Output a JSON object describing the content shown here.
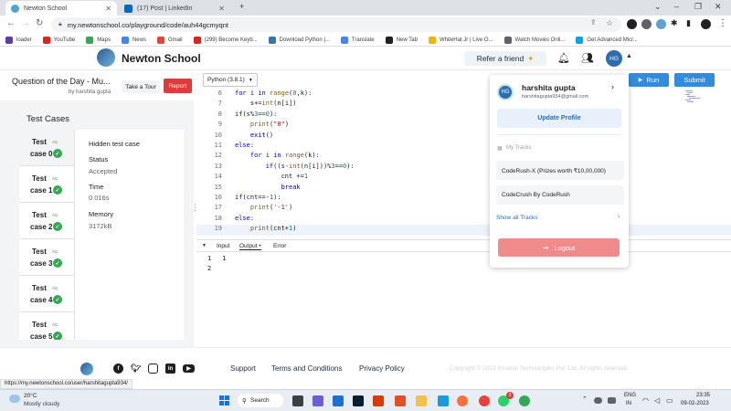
{
  "browser": {
    "tabs": [
      {
        "title": "Newton School",
        "active": true,
        "favicon_color": "#4ea3d8"
      },
      {
        "title": "(17) Post | LinkedIn",
        "active": false,
        "favicon_color": "#0a66c2"
      }
    ],
    "url": "my.newtonschool.co/playground/code/auh44gcmyqnt",
    "bookmarks": [
      {
        "label": "loader",
        "color": "#5b3ea6"
      },
      {
        "label": "YouTube",
        "color": "#e62117"
      },
      {
        "label": "Maps",
        "color": "#34a853"
      },
      {
        "label": "News",
        "color": "#4285f4"
      },
      {
        "label": "Gmail",
        "color": "#ea4335"
      },
      {
        "label": "(299) Become Keyb...",
        "color": "#e62117"
      },
      {
        "label": "Download Python |...",
        "color": "#3776ab"
      },
      {
        "label": "Translate",
        "color": "#4285f4"
      },
      {
        "label": "New Tab",
        "color": "#202124"
      },
      {
        "label": "WhiteHat Jr | Live O...",
        "color": "#f4b400"
      },
      {
        "label": "Watch Movies Onli...",
        "color": "#5f6368"
      },
      {
        "label": "Get Advanced Micr...",
        "color": "#00a4ef"
      }
    ],
    "status_url": "https://my.newtonschool.co/user/harshitagupta934/"
  },
  "site": {
    "brand": "Newton School",
    "refer_label": "Refer a friend",
    "avatar_initials": "HG"
  },
  "question": {
    "title": "Question of the Day - Mu...",
    "author": "by harshita gupta",
    "tour_label": "Take a Tour",
    "report_label": "Report"
  },
  "testcases": {
    "heading": "Test Cases",
    "items": [
      {
        "line1": "Test",
        "line2": "case 0",
        "badge": "AC"
      },
      {
        "line1": "Test",
        "line2": "case 1",
        "badge": "AC"
      },
      {
        "line1": "Test",
        "line2": "case 2",
        "badge": "AC"
      },
      {
        "line1": "Test",
        "line2": "case 3",
        "badge": "AC"
      },
      {
        "line1": "Test",
        "line2": "case 4",
        "badge": "AC"
      },
      {
        "line1": "Test",
        "line2": "case 5",
        "badge": "AC"
      }
    ],
    "detail": {
      "title": "Hidden test case",
      "status_label": "Status",
      "status_value": "Accepted",
      "time_label": "Time",
      "time_value": "0.016s",
      "memory_label": "Memory",
      "memory_value": "3172kB"
    }
  },
  "editor": {
    "language": "Python (3.8.1)",
    "run_label": "Run",
    "submit_label": "Submit",
    "lines": [
      {
        "n": "6",
        "code": "for i in range(0,k):"
      },
      {
        "n": "7",
        "code": "    s+=int(n[i])"
      },
      {
        "n": "8",
        "code": "if(s%3==0):"
      },
      {
        "n": "9",
        "code": "    print(\"0\")"
      },
      {
        "n": "10",
        "code": "    exit()"
      },
      {
        "n": "11",
        "code": "else:"
      },
      {
        "n": "12",
        "code": "    for i in range(k):"
      },
      {
        "n": "13",
        "code": "        if((s-int(n[i]))%3==0):"
      },
      {
        "n": "14",
        "code": "            cnt +=1"
      },
      {
        "n": "15",
        "code": "            break"
      },
      {
        "n": "16",
        "code": "if(cnt==-1):"
      },
      {
        "n": "17",
        "code": "    print('-1')"
      },
      {
        "n": "18",
        "code": "else:"
      },
      {
        "n": "19",
        "code": "    print(cnt+1)"
      }
    ],
    "highlighted_line": "19"
  },
  "io": {
    "tabs": [
      "Input",
      "Output •",
      "Error"
    ],
    "active_tab": "Output •",
    "output_lines": [
      {
        "n": "1",
        "text": "1"
      },
      {
        "n": "2",
        "text": ""
      }
    ]
  },
  "profile_menu": {
    "name": "harshita gupta",
    "email": "harshitagupta934@gmail.com",
    "update_label": "Update Profile",
    "tracks_label": "My Tracks",
    "tracks": [
      "CodeRush-X (Prizes worth ₹10,00,000)",
      "CodeCrush By CodeRush"
    ],
    "show_all_label": "Show all Tracks",
    "logout_label": "Logout",
    "avatar_initials": "HG"
  },
  "footer": {
    "links": [
      "Support",
      "Terms and Conditions",
      "Privacy Policy"
    ],
    "copyright": "Copyright © 2023 Incanus Technologies Pvt. Ltd. All rights reserved."
  },
  "taskbar": {
    "weather_temp": "20°C",
    "weather_desc": "Mostly cloudy",
    "search_label": "Search",
    "badge_count": "3",
    "lang_line1": "ENG",
    "lang_line2": "IN",
    "time": "23:35",
    "date": "09-02-2023"
  }
}
